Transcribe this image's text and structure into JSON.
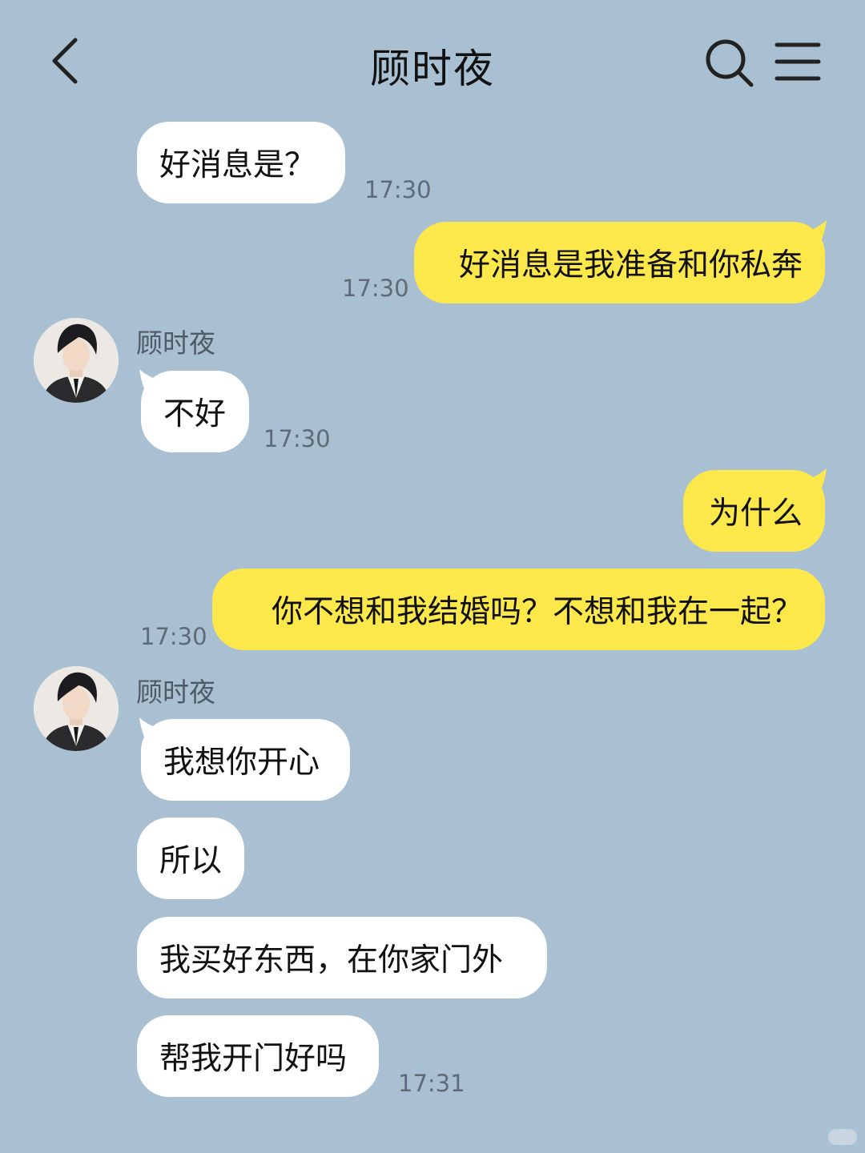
{
  "header": {
    "title": "顾时夜",
    "back_icon": "chevron-left-icon",
    "search_icon": "search-icon",
    "menu_icon": "menu-icon"
  },
  "colors": {
    "background": "#a9c0d3",
    "incoming_bubble": "#ffffff",
    "outgoing_bubble": "#fde84c",
    "timestamp": "#5f6b76"
  },
  "messages": [
    {
      "id": "m1",
      "direction": "in",
      "text": "好消息是？",
      "time": "17:30"
    },
    {
      "id": "m2",
      "direction": "out",
      "text": "好消息是我准备和你私奔",
      "time": "17:30"
    },
    {
      "id": "m3",
      "direction": "in",
      "sender": "顾时夜",
      "text": "不好",
      "time": "17:30"
    },
    {
      "id": "m4",
      "direction": "out",
      "text": "为什么"
    },
    {
      "id": "m5",
      "direction": "out",
      "text": "你不想和我结婚吗？不想和我在一起？",
      "time": "17:30"
    },
    {
      "id": "m6",
      "direction": "in",
      "sender": "顾时夜",
      "text": "我想你开心"
    },
    {
      "id": "m7",
      "direction": "in",
      "text": "所以"
    },
    {
      "id": "m8",
      "direction": "in",
      "text": "我买好东西，在你家门外"
    },
    {
      "id": "m9",
      "direction": "in",
      "text": "帮我开门好吗",
      "time": "17:31"
    }
  ]
}
